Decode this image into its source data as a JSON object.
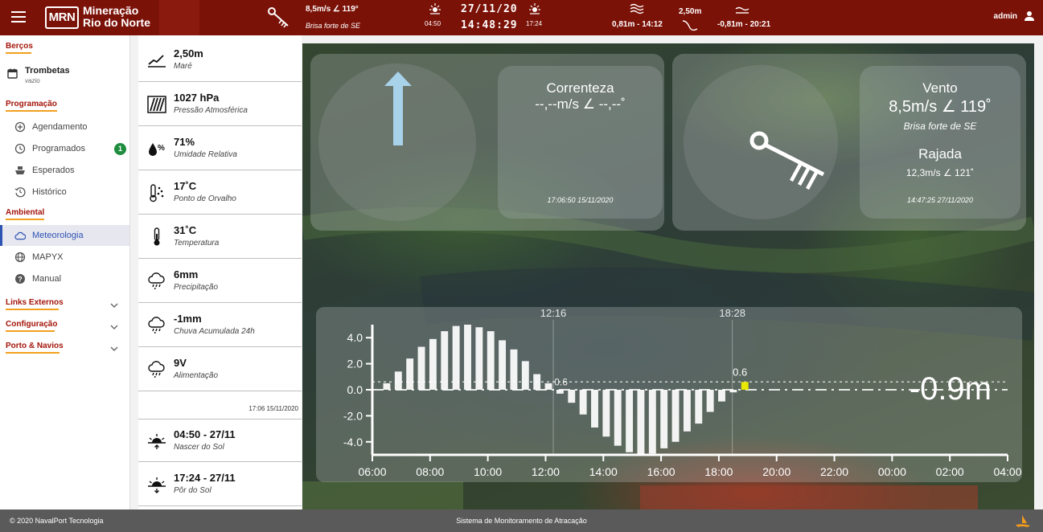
{
  "header": {
    "brand_short": "MRN",
    "brand_line1": "Mineração",
    "brand_line2": "Rio do Norte",
    "wind_value": "8,5m/s ∠ 119°",
    "wind_desc": "Brisa forte de SE",
    "sunrise_time": "04:50",
    "date": "27/11/20",
    "time": "14:48:29",
    "sunset_time": "17:24",
    "tide_high": "0,81m - 14:12",
    "tide_level": "2,50m",
    "tide_low": "-0,81m - 20:21",
    "user": "admin",
    "icons": [
      "menu-icon",
      "wind-vane-icon",
      "sunrise-icon",
      "sunset-icon",
      "high-tide-icon",
      "low-tide-icon",
      "user-icon"
    ]
  },
  "sidebar": {
    "berths_title": "Berços",
    "berth_name": "Trombetas",
    "berth_status": "vazio",
    "programacao_title": "Programação",
    "programacao_items": [
      {
        "label": "Agendamento",
        "icon": "add-clock-icon"
      },
      {
        "label": "Programados",
        "icon": "clock-icon",
        "badge": "1"
      },
      {
        "label": "Esperados",
        "icon": "ship-icon"
      },
      {
        "label": "Histórico",
        "icon": "history-icon"
      }
    ],
    "ambiental_title": "Ambiental",
    "ambiental_items": [
      {
        "label": "Meteorologia",
        "icon": "cloud-icon",
        "active": true
      },
      {
        "label": "MAPYX",
        "icon": "globe-icon"
      },
      {
        "label": "Manual",
        "icon": "help-icon"
      }
    ],
    "links_title": "Links Externos",
    "config_title": "Configuração",
    "porto_title": "Porto & Navios"
  },
  "sensors": [
    {
      "value": "2,50m",
      "label": "Maré",
      "icon": "tide-chart-icon"
    },
    {
      "value": "1027 hPa",
      "label": "Pressão Atmosférica",
      "icon": "pressure-icon"
    },
    {
      "value": "71%",
      "label": "Umidade Relativa",
      "icon": "humidity-icon"
    },
    {
      "value": "17˚C",
      "label": "Ponto de Orvalho",
      "icon": "dew-point-icon"
    },
    {
      "value": "31˚C",
      "label": "Temperatura",
      "icon": "thermometer-icon"
    },
    {
      "value": "6mm",
      "label": "Precipitação",
      "icon": "rain-icon"
    },
    {
      "value": "-1mm",
      "label": "Chuva Acumulada 24h",
      "icon": "rain-icon"
    },
    {
      "value": "9V",
      "label": "Alimentação",
      "icon": "rain-icon"
    }
  ],
  "sensor_timestamp": "17:06 15/11/2020",
  "sun": [
    {
      "value": "04:50 - 27/11",
      "label": "Nascer do Sol",
      "icon": "sunrise-icon"
    },
    {
      "value": "17:24 - 27/11",
      "label": "Pôr do Sol",
      "icon": "sunset-icon"
    }
  ],
  "current_panel": {
    "title": "Correnteza",
    "value": "--,--m/s ∠ --,--˚",
    "timestamp": "17:06:50 15/11/2020",
    "icon": "current-arrow-icon"
  },
  "wind_panel": {
    "title": "Vento",
    "value": "8,5m/s ∠ 119˚",
    "desc": "Brisa forte de SE",
    "gust_title": "Rajada",
    "gust_value": "12,3m/s ∠ 121˚",
    "timestamp": "14:47:25 27/11/2020",
    "icon": "wind-vane-icon"
  },
  "chart_data": {
    "type": "bar",
    "title": "",
    "current_level": "-0.9m",
    "marker_times": [
      "12:16",
      "18:28"
    ],
    "threshold_label": "0.6",
    "threshold_value": 0.6,
    "point_label": "0.6",
    "ylim": [
      -5,
      5
    ],
    "yticks": [
      "4.0",
      "2.0",
      "0.0",
      "-2.0",
      "-4.0"
    ],
    "ytick_values": [
      4,
      2,
      0,
      -2,
      -4
    ],
    "xticks": [
      "06:00",
      "08:00",
      "10:00",
      "12:00",
      "14:00",
      "16:00",
      "18:00",
      "20:00",
      "22:00",
      "00:00",
      "02:00",
      "04:00"
    ],
    "x_start_hour": 6,
    "x_end_hour": 28,
    "bar_start_hour": 6.5,
    "bar_step_hours": 0.4,
    "values": [
      0.5,
      1.4,
      2.4,
      3.3,
      3.9,
      4.5,
      4.9,
      5.0,
      4.8,
      4.5,
      3.8,
      3.1,
      2.2,
      1.2,
      0.5,
      -0.3,
      -1.0,
      -1.9,
      -2.9,
      -3.6,
      -4.3,
      -4.8,
      -5.0,
      -4.9,
      -4.5,
      -4.0,
      -3.2,
      -2.6,
      -1.7,
      -0.9,
      -0.2
    ],
    "highlight_value": 0.6,
    "colors": {
      "bars": "#ffffff",
      "highlight": "#e8e800",
      "axis": "#ffffff",
      "current_level": "#ffffff"
    }
  },
  "footer": {
    "copyright": "© 2020 NavalPort Tecnologia",
    "system_name": "Sistema de Monitoramento de Atracação",
    "icon": "navalport-logo-icon"
  },
  "colors": {
    "topbar": "#7b1208",
    "accent_underline": "#f2a01e",
    "section_title": "#a3150a",
    "active_nav": "#2d53b3",
    "badge": "#1e8e3e",
    "footer": "#5a5a5a"
  }
}
